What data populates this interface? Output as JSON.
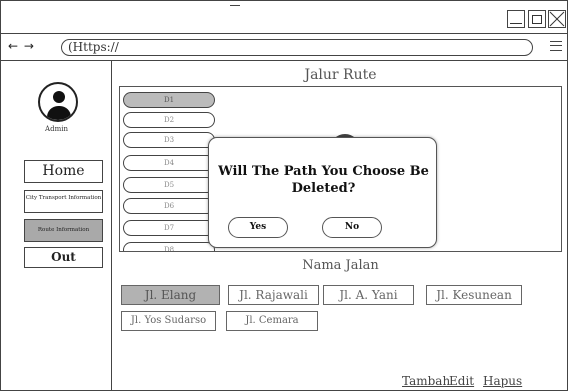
{
  "browser": {
    "nav_arrows": "← →",
    "url": "(Https://",
    "menu_icon": "hamburger-menu-icon"
  },
  "window_controls": {
    "minimize_icon": "minimize-icon",
    "maximize_icon": "maximize-icon",
    "close_icon": "close-icon"
  },
  "sidebar": {
    "avatar_icon": "user-avatar-icon",
    "user_label": "Admin",
    "nav": {
      "home": "Home",
      "city": "City Transport Information",
      "route": "Route Information",
      "out": "Out"
    }
  },
  "main": {
    "route_title": "Jalur Rute",
    "routes": [
      "D1",
      "D2",
      "D3",
      "D4",
      "D5",
      "D6",
      "D7",
      "D8"
    ],
    "street_title": "Nama Jalan",
    "streets": [
      "Jl. Elang",
      "Jl. Rajawali",
      "Jl. A. Yani",
      "Jl. Kesunean",
      "Jl. Yos Sudarso",
      "Jl. Cemara"
    ],
    "actions": {
      "add": "Tambah",
      "edit": "Edit",
      "delete": "Hapus"
    }
  },
  "dialog": {
    "message": "Will The Path You Choose Be Deleted?",
    "yes": "Yes",
    "no": "No"
  }
}
